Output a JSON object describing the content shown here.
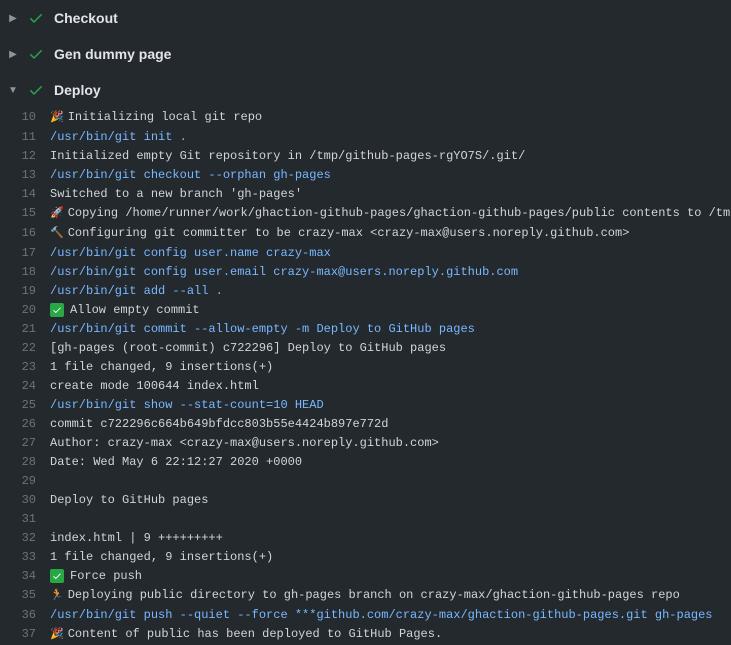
{
  "steps": [
    {
      "title": "Checkout",
      "expanded": false
    },
    {
      "title": "Gen dummy page",
      "expanded": false
    },
    {
      "title": "Deploy",
      "expanded": true
    }
  ],
  "log": [
    {
      "n": 10,
      "type": "emoji",
      "icon": "🎉",
      "text": "Initializing local git repo"
    },
    {
      "n": 11,
      "type": "cmd",
      "text": "/usr/bin/git init ."
    },
    {
      "n": 12,
      "type": "plain",
      "text": "Initialized empty Git repository in /tmp/github-pages-rgYO7S/.git/"
    },
    {
      "n": 13,
      "type": "cmd",
      "text": "/usr/bin/git checkout --orphan gh-pages"
    },
    {
      "n": 14,
      "type": "plain",
      "text": "Switched to a new branch 'gh-pages'"
    },
    {
      "n": 15,
      "type": "emoji",
      "icon": "🚀",
      "text": "Copying /home/runner/work/ghaction-github-pages/ghaction-github-pages/public contents to /tm"
    },
    {
      "n": 16,
      "type": "emoji",
      "icon": "🔨",
      "text": "Configuring git committer to be crazy-max <crazy-max@users.noreply.github.com>"
    },
    {
      "n": 17,
      "type": "cmd",
      "text": "/usr/bin/git config user.name crazy-max"
    },
    {
      "n": 18,
      "type": "cmd",
      "text": "/usr/bin/git config user.email crazy-max@users.noreply.github.com"
    },
    {
      "n": 19,
      "type": "cmd",
      "text": "/usr/bin/git add --all ."
    },
    {
      "n": 20,
      "type": "badge",
      "text": "Allow empty commit"
    },
    {
      "n": 21,
      "type": "cmd",
      "text": "/usr/bin/git commit --allow-empty -m Deploy to GitHub pages"
    },
    {
      "n": 22,
      "type": "plain",
      "text": "[gh-pages (root-commit) c722296] Deploy to GitHub pages"
    },
    {
      "n": 23,
      "type": "plain",
      "text": " 1 file changed, 9 insertions(+)"
    },
    {
      "n": 24,
      "type": "plain",
      "text": "  create mode 100644 index.html"
    },
    {
      "n": 25,
      "type": "cmd",
      "text": "/usr/bin/git show --stat-count=10 HEAD"
    },
    {
      "n": 26,
      "type": "plain",
      "text": "commit c722296c664b649bfdcc803b55e4424b897e772d"
    },
    {
      "n": 27,
      "type": "plain",
      "text": "Author: crazy-max <crazy-max@users.noreply.github.com>"
    },
    {
      "n": 28,
      "type": "plain",
      "text": "Date:   Wed May 6 22:12:27 2020 +0000"
    },
    {
      "n": 29,
      "type": "plain",
      "text": ""
    },
    {
      "n": 30,
      "type": "plain",
      "text": "    Deploy to GitHub pages"
    },
    {
      "n": 31,
      "type": "plain",
      "text": ""
    },
    {
      "n": 32,
      "type": "plain",
      "text": " index.html | 9 +++++++++"
    },
    {
      "n": 33,
      "type": "plain",
      "text": " 1 file changed, 9 insertions(+)"
    },
    {
      "n": 34,
      "type": "badge",
      "text": "Force push"
    },
    {
      "n": 35,
      "type": "emoji",
      "icon": "🏃",
      "text": "Deploying public directory to gh-pages branch on crazy-max/ghaction-github-pages repo"
    },
    {
      "n": 36,
      "type": "cmd",
      "text": "/usr/bin/git push --quiet --force ***github.com/crazy-max/ghaction-github-pages.git gh-pages"
    },
    {
      "n": 37,
      "type": "emoji",
      "icon": "🎉",
      "text": "Content of public has been deployed to GitHub Pages."
    }
  ]
}
